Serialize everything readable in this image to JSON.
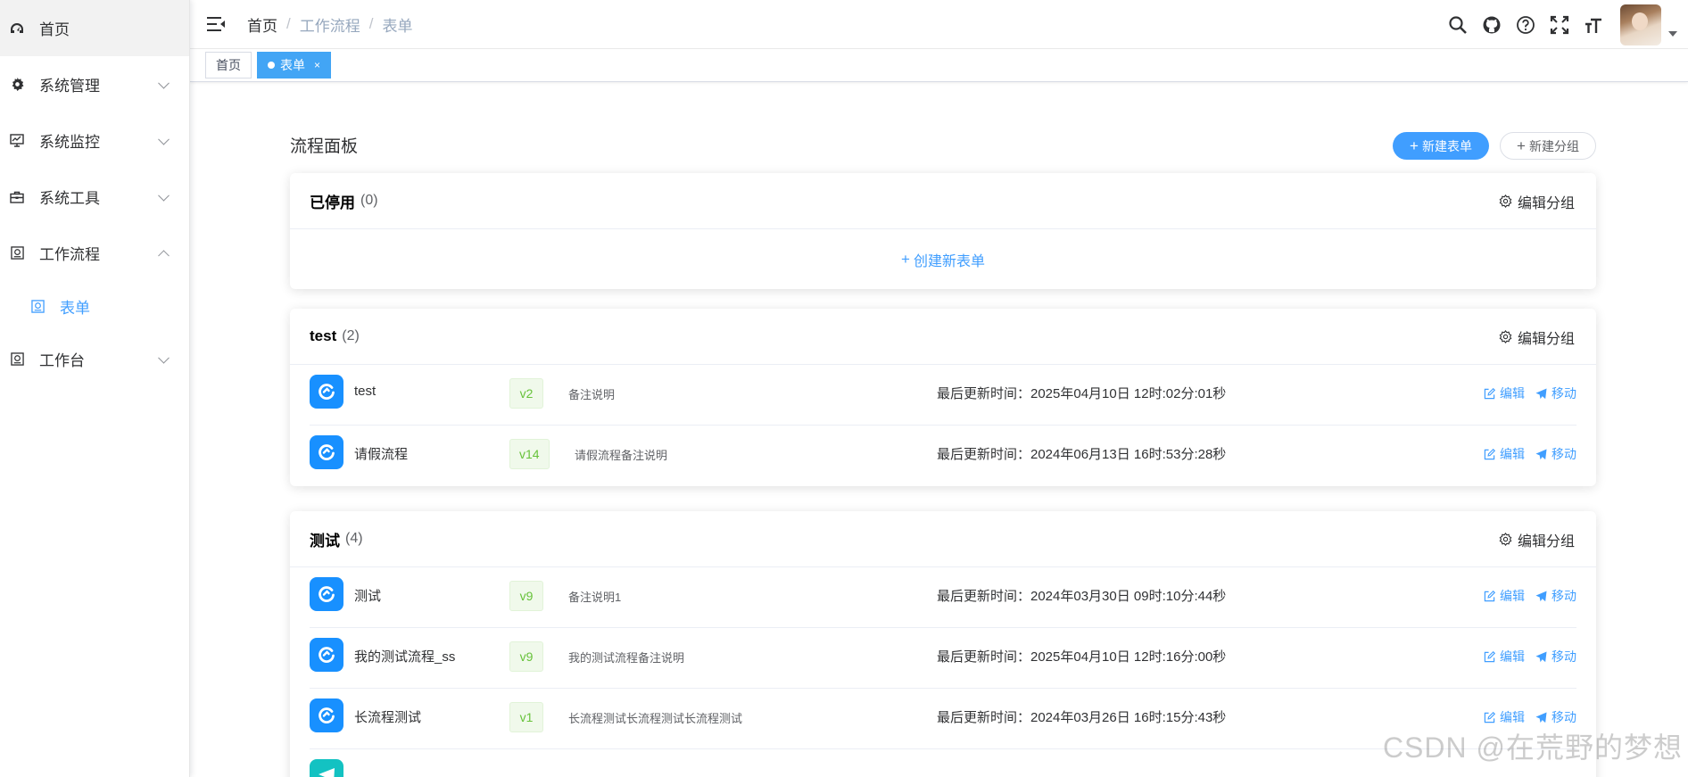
{
  "sidebar": {
    "items": [
      {
        "label": "首页",
        "icon": "dashboard-icon"
      },
      {
        "label": "系统管理",
        "icon": "gear-icon"
      },
      {
        "label": "系统监控",
        "icon": "monitor-icon"
      },
      {
        "label": "系统工具",
        "icon": "toolbox-icon"
      },
      {
        "label": "工作流程",
        "icon": "workflow-icon"
      },
      {
        "label": "工作台",
        "icon": "workbench-icon"
      }
    ],
    "sub_item": {
      "label": "表单",
      "icon": "form-icon"
    }
  },
  "header": {
    "breadcrumb": [
      "首页",
      "工作流程",
      "表单"
    ],
    "separator": "/"
  },
  "tags": [
    {
      "label": "首页"
    },
    {
      "label": "表单",
      "close": "×"
    }
  ],
  "main": {
    "title": "流程面板",
    "btn_new_form": "新建表单",
    "btn_new_group": "新建分组",
    "plus": "+",
    "edit_group": "编辑分组",
    "create_new_form": "创建新表单",
    "edit_label": "编辑",
    "move_label": "移动",
    "time_prefix": "最后更新时间："
  },
  "groups": [
    {
      "name": "已停用",
      "count": "(0)",
      "rows": []
    },
    {
      "name": "test",
      "count": "(2)",
      "rows": [
        {
          "name": "test",
          "version": "v2",
          "desc": "备注说明",
          "time": "最后更新时间：2025年04月10日 12时:02分:01秒"
        },
        {
          "name": "请假流程",
          "version": "v14",
          "desc": "请假流程备注说明",
          "time": "最后更新时间：2024年06月13日 16时:53分:28秒"
        }
      ]
    },
    {
      "name": "测试",
      "count": "(4)",
      "rows": [
        {
          "name": "测试",
          "version": "v9",
          "desc": "备注说明1",
          "time": "最后更新时间：2024年03月30日 09时:10分:44秒"
        },
        {
          "name": "我的测试流程_ss",
          "version": "v9",
          "desc": "我的测试流程备注说明",
          "time": "最后更新时间：2025年04月10日 12时:16分:00秒"
        },
        {
          "name": "长流程测试",
          "version": "v1",
          "desc": "长流程测试长流程测试长流程测试",
          "time": "最后更新时间：2024年03月26日 16时:15分:43秒"
        }
      ]
    }
  ],
  "watermark": "CSDN @在荒野的梦想",
  "colors": {
    "primary": "#409eff",
    "app_icon": "#1890ff",
    "version_text": "#67c23a",
    "teal": "#13c2c2"
  }
}
